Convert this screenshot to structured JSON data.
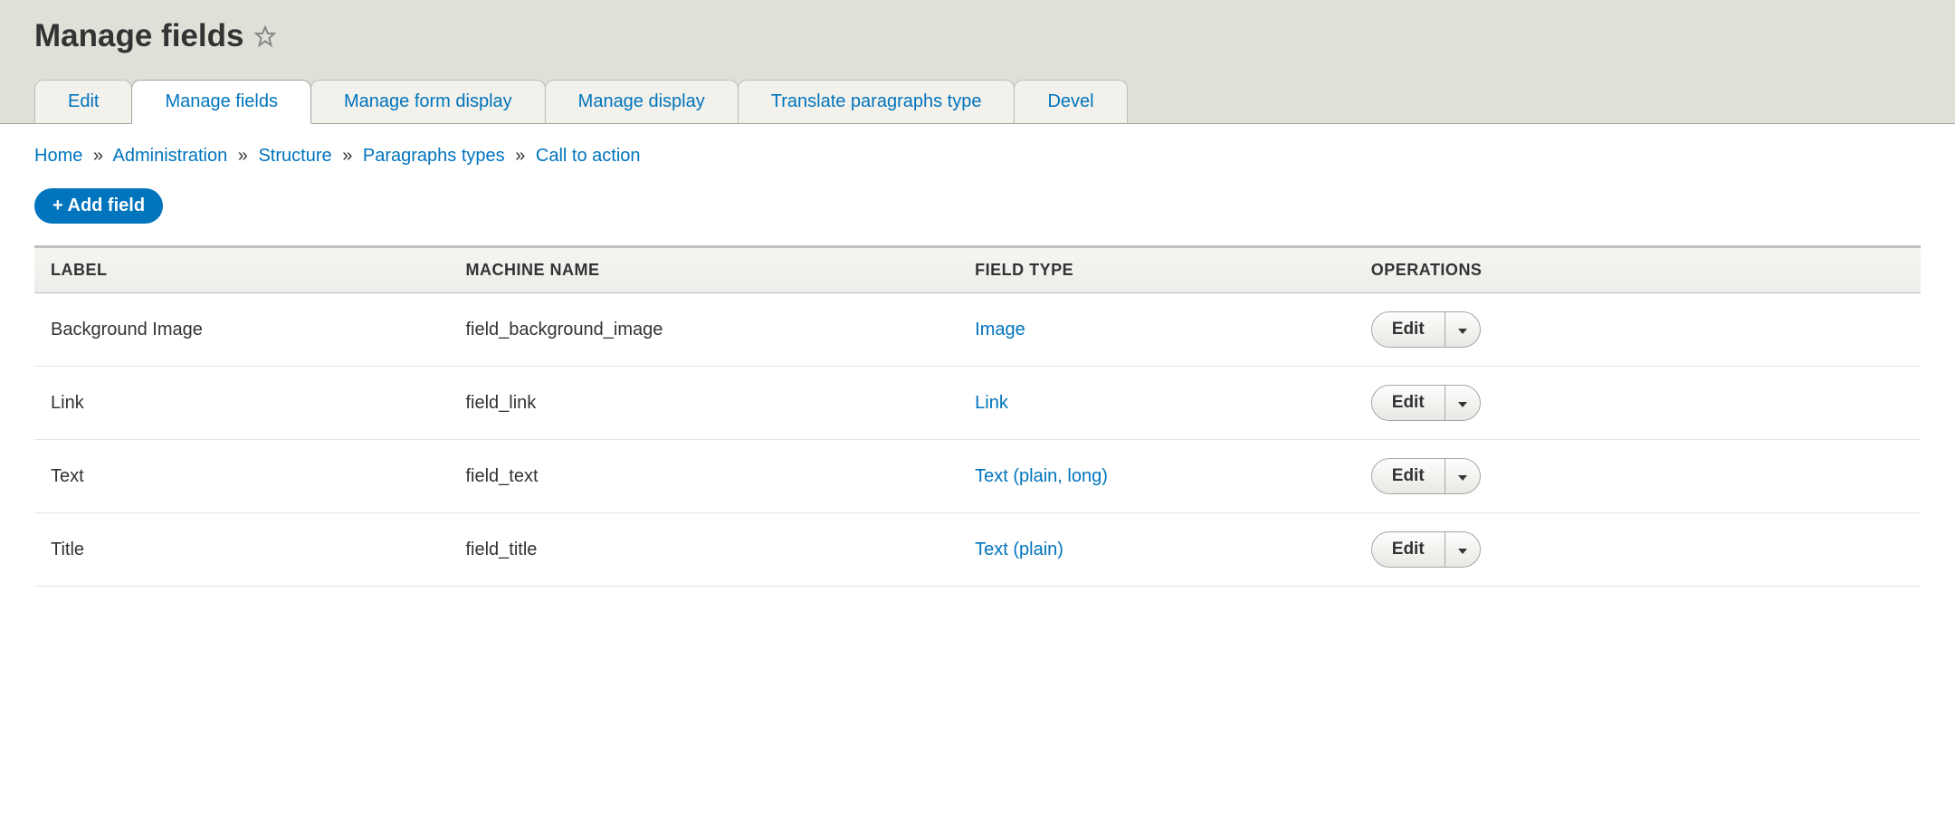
{
  "page_title": "Manage fields",
  "tabs": [
    {
      "label": "Edit"
    },
    {
      "label": "Manage fields"
    },
    {
      "label": "Manage form display"
    },
    {
      "label": "Manage display"
    },
    {
      "label": "Translate paragraphs type"
    },
    {
      "label": "Devel"
    }
  ],
  "breadcrumb": [
    "Home",
    "Administration",
    "Structure",
    "Paragraphs types",
    "Call to action"
  ],
  "add_field_label": "+ Add field",
  "table": {
    "headers": {
      "label": "LABEL",
      "machine": "MACHINE NAME",
      "type": "FIELD TYPE",
      "ops": "OPERATIONS"
    },
    "rows": [
      {
        "label": "Background Image",
        "machine": "field_background_image",
        "type": "Image",
        "op": "Edit"
      },
      {
        "label": "Link",
        "machine": "field_link",
        "type": "Link",
        "op": "Edit"
      },
      {
        "label": "Text",
        "machine": "field_text",
        "type": "Text (plain, long)",
        "op": "Edit"
      },
      {
        "label": "Title",
        "machine": "field_title",
        "type": "Text (plain)",
        "op": "Edit"
      }
    ]
  }
}
